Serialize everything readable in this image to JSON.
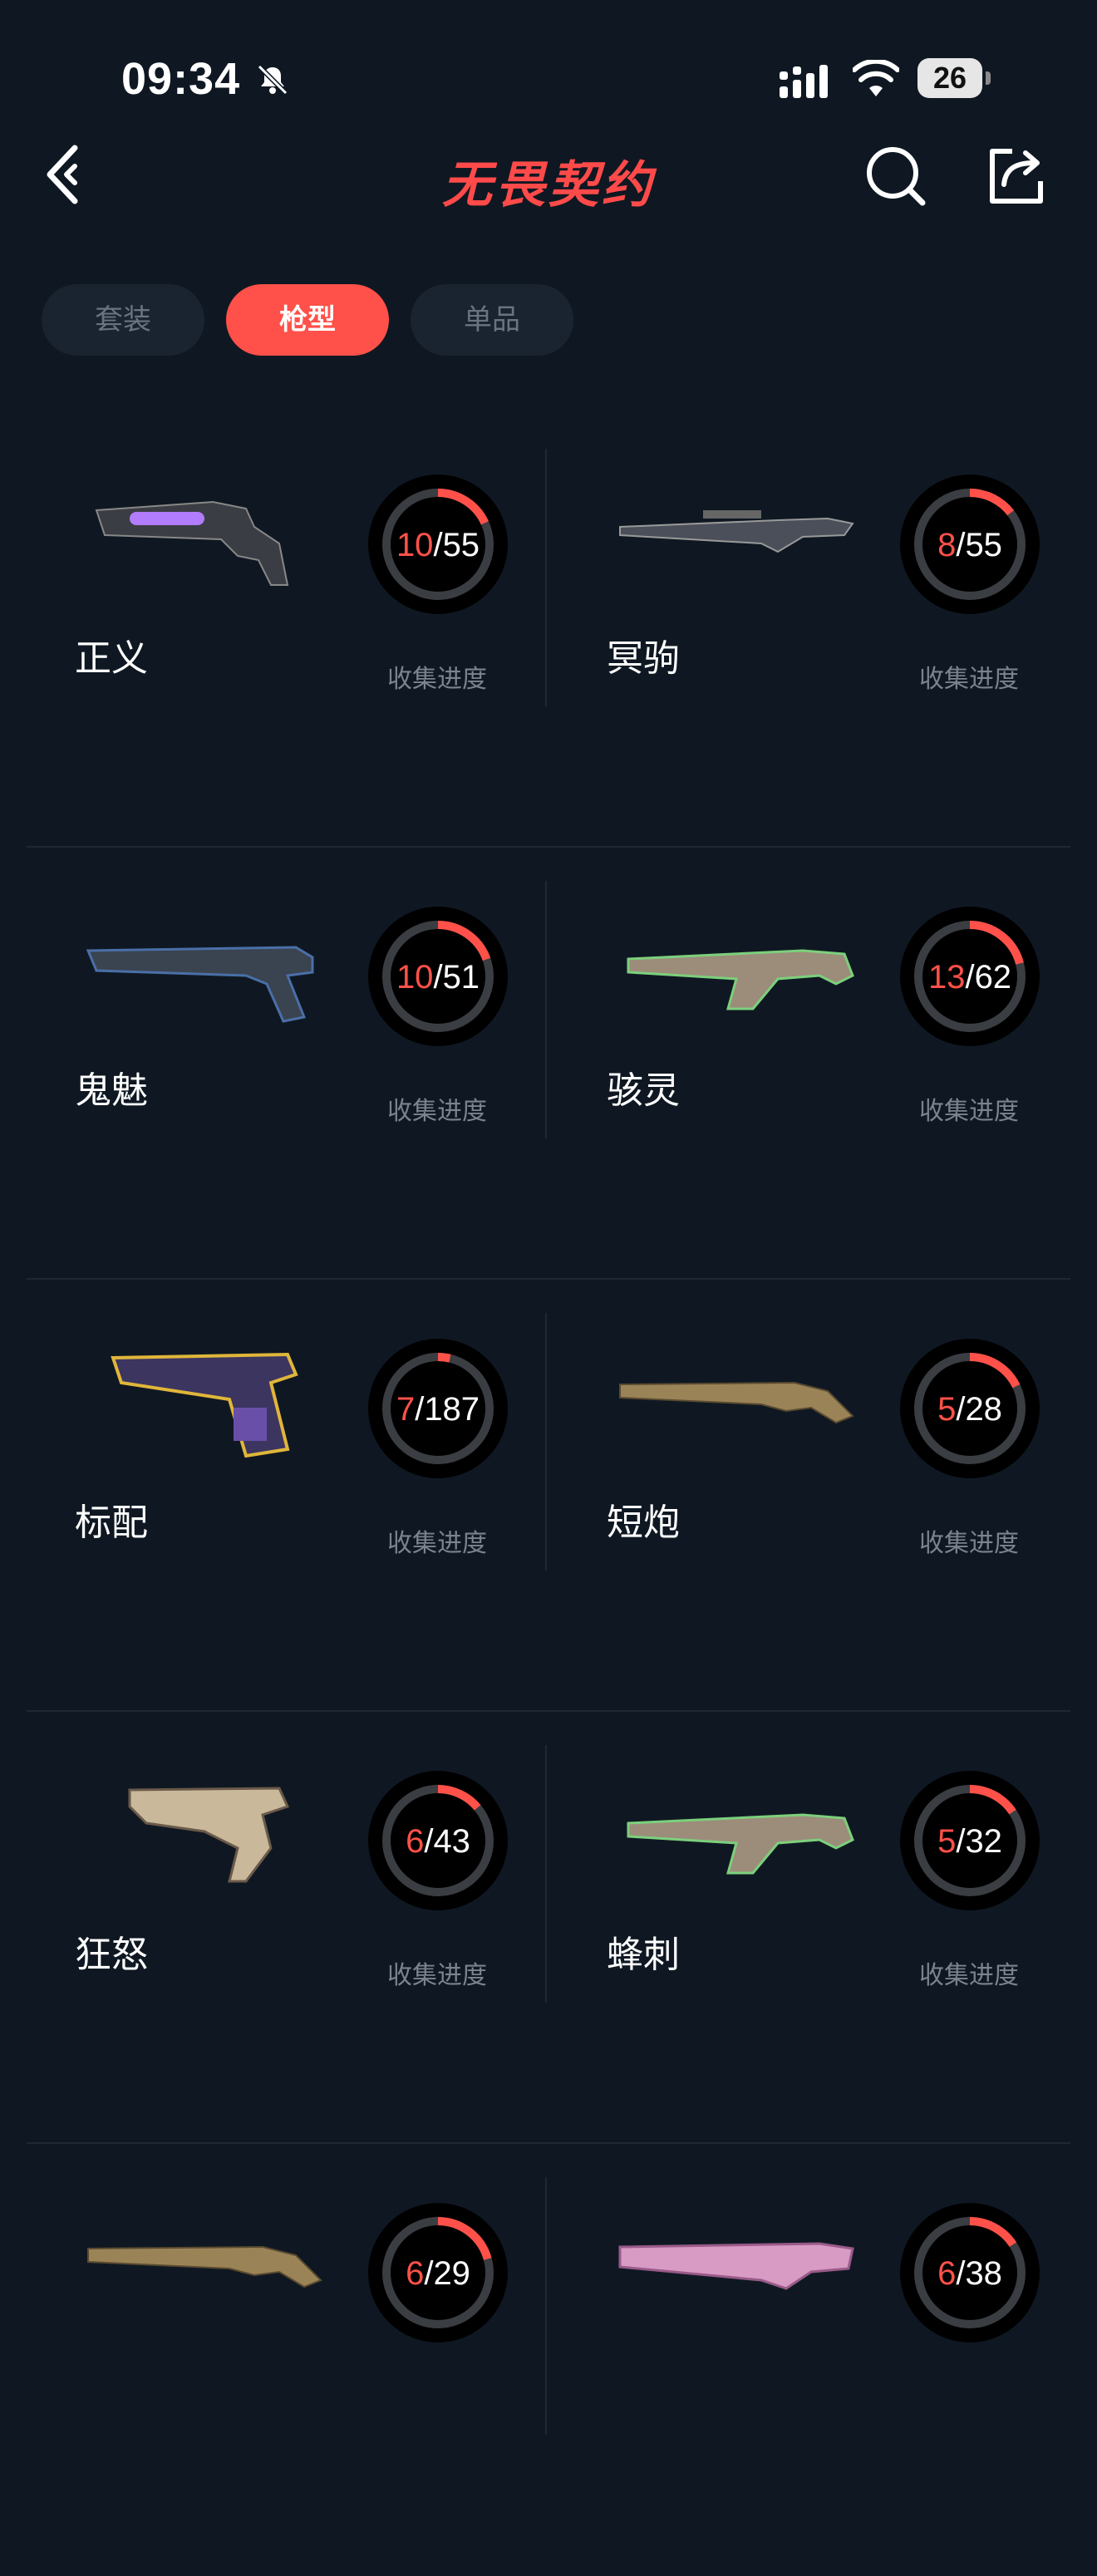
{
  "status_bar": {
    "time": "09:34",
    "battery": "26"
  },
  "header": {
    "title": "无畏契约"
  },
  "tabs": [
    {
      "label": "套装",
      "active": false
    },
    {
      "label": "枪型",
      "active": true
    },
    {
      "label": "单品",
      "active": false
    }
  ],
  "progress_label": "收集进度",
  "weapons": [
    {
      "name": "正义",
      "collected": 10,
      "total": 55,
      "icon": "revolver-icon"
    },
    {
      "name": "冥驹",
      "collected": 8,
      "total": 55,
      "icon": "sniper-rifle-icon"
    },
    {
      "name": "鬼魅",
      "collected": 10,
      "total": 51,
      "icon": "pistol-icon"
    },
    {
      "name": "骇灵",
      "collected": 13,
      "total": 62,
      "icon": "smg-icon"
    },
    {
      "name": "标配",
      "collected": 7,
      "total": 187,
      "icon": "sidearm-icon"
    },
    {
      "name": "短炮",
      "collected": 5,
      "total": 28,
      "icon": "shotgun-icon"
    },
    {
      "name": "狂怒",
      "collected": 6,
      "total": 43,
      "icon": "machine-pistol-icon"
    },
    {
      "name": "蜂刺",
      "collected": 5,
      "total": 32,
      "icon": "smg-icon"
    },
    {
      "name": "",
      "collected": 6,
      "total": 29,
      "icon": "shotgun-icon"
    },
    {
      "name": "",
      "collected": 6,
      "total": 38,
      "icon": "rifle-icon"
    }
  ],
  "colors": {
    "accent": "#ff5149",
    "background": "#0f1822",
    "ring_track": "#3a3d42"
  }
}
